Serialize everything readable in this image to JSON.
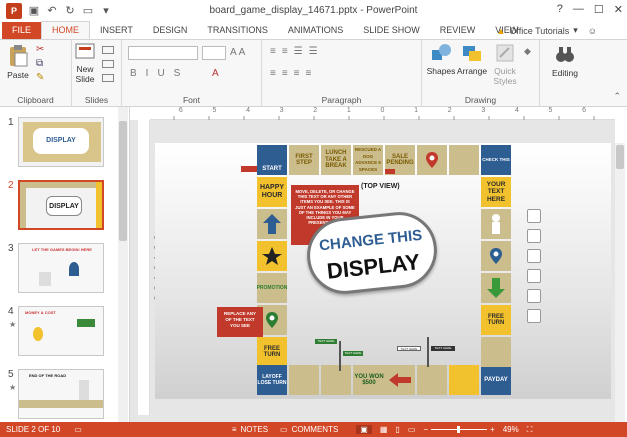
{
  "window": {
    "app_badge": "P",
    "title": "board_game_display_14671.pptx - PowerPoint",
    "controls": [
      "?",
      "—",
      "☐",
      "✕"
    ]
  },
  "tabs": [
    "FILE",
    "HOME",
    "INSERT",
    "DESIGN",
    "TRANSITIONS",
    "ANIMATIONS",
    "SLIDE SHOW",
    "REVIEW",
    "VIEW"
  ],
  "account": "Office Tutorials",
  "ribbon": {
    "groups": {
      "clipboard": "Clipboard",
      "slides": "Slides",
      "font": "Font",
      "paragraph": "Paragraph",
      "drawing": "Drawing"
    },
    "paste": "Paste",
    "new_slide": "New",
    "new_slide2": "Slide",
    "shapes": "Shapes",
    "arrange": "Arrange",
    "quick_styles": "Quick",
    "quick_styles2": "Styles",
    "editing": "Editing",
    "font_size": "A A"
  },
  "thumbnails": [
    {
      "num": "1",
      "label": "DISPLAY",
      "star": ""
    },
    {
      "num": "2",
      "label": "DISPLAY",
      "star": ""
    },
    {
      "num": "3",
      "label": "LET THE GAMES BEGIN! HERE",
      "star": ""
    },
    {
      "num": "4",
      "label": "MONEY & COST",
      "star": "★"
    },
    {
      "num": "5",
      "label": "END OF THE ROAD",
      "star": "★"
    }
  ],
  "slide": {
    "top_row": [
      "START",
      "FIRST STEP",
      "LUNCH TAKE A BREAK",
      "RESCUED A DOG ADVANCE 5 SPACES",
      "SALE PENDING",
      "",
      "",
      "CHECK THIS"
    ],
    "left_col": [
      "HAPPY HOUR",
      "",
      "",
      "PROMOTION",
      "",
      "FREE TURN",
      "LAYOFF LOSE TURN"
    ],
    "right_col": [
      "YOUR TEXT HERE",
      "",
      "",
      "",
      "FREE TURN",
      "",
      "PAYDAY"
    ],
    "bottom_row": [
      "",
      "",
      "YOU WON $500",
      "",
      ""
    ],
    "top_view": "(TOP VIEW)",
    "callout_red": "MOVE, DELETE, OR CHANGE THIS TEXT OR ANY OTHER ITEMS YOU SEE. THIS IS JUST AN EXAMPLE OF SOME OF THE THINGS YOU MAY INCLUDE IN YOUR PRESENTATION.",
    "callout_left": "REPLACE ANY OF THE TEXT YOU SEE",
    "main_line1": "CHANGE THIS",
    "main_line2": "DISPLAY",
    "sign1": "TEXT HERE",
    "sign2": "TEXT HERE",
    "sign3": "TEXT HERE",
    "sign4": "TEXT HERE"
  },
  "ruler_marks": [
    "6",
    "5",
    "4",
    "3",
    "2",
    "1",
    "0",
    "1",
    "2",
    "3",
    "4",
    "5",
    "6"
  ],
  "status": {
    "slide": "SLIDE 2 OF 10",
    "notes": "NOTES",
    "comments": "COMMENTS",
    "zoom": "49%"
  },
  "colors": {
    "accent": "#d24726",
    "tan": "#cbbd8c",
    "yellow": "#f2c12e",
    "blue": "#2e5d92"
  }
}
